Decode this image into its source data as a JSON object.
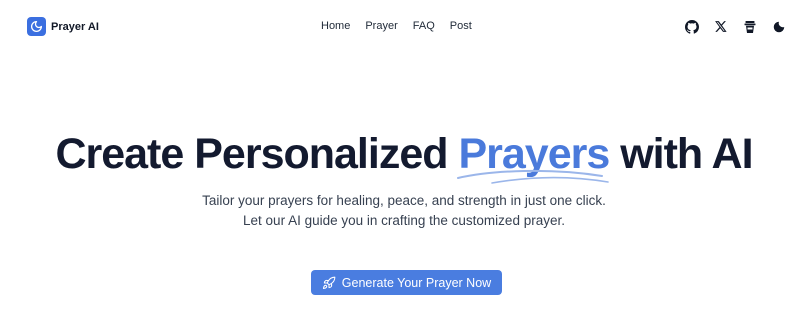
{
  "brand": {
    "name": "Prayer AI",
    "logo_icon": "moon-logo-icon",
    "accent": "#3b6fe0"
  },
  "nav": {
    "items": [
      {
        "label": "Home"
      },
      {
        "label": "Prayer"
      },
      {
        "label": "FAQ"
      },
      {
        "label": "Post"
      }
    ]
  },
  "header_icons": [
    "github-icon",
    "x-icon",
    "coffee-icon",
    "moon-icon"
  ],
  "hero": {
    "title_before": "Create Personalized",
    "title_highlight": "Prayers",
    "title_after": "with AI",
    "highlight_color": "#4a7adb",
    "subtitle_line1": "Tailor your prayers for healing, peace, and strength in just one click.",
    "subtitle_line2": "Let our AI guide you in crafting the customized prayer."
  },
  "cta": {
    "label": "Generate Your Prayer Now",
    "icon": "rocket-icon",
    "color": "#4a7de0"
  }
}
